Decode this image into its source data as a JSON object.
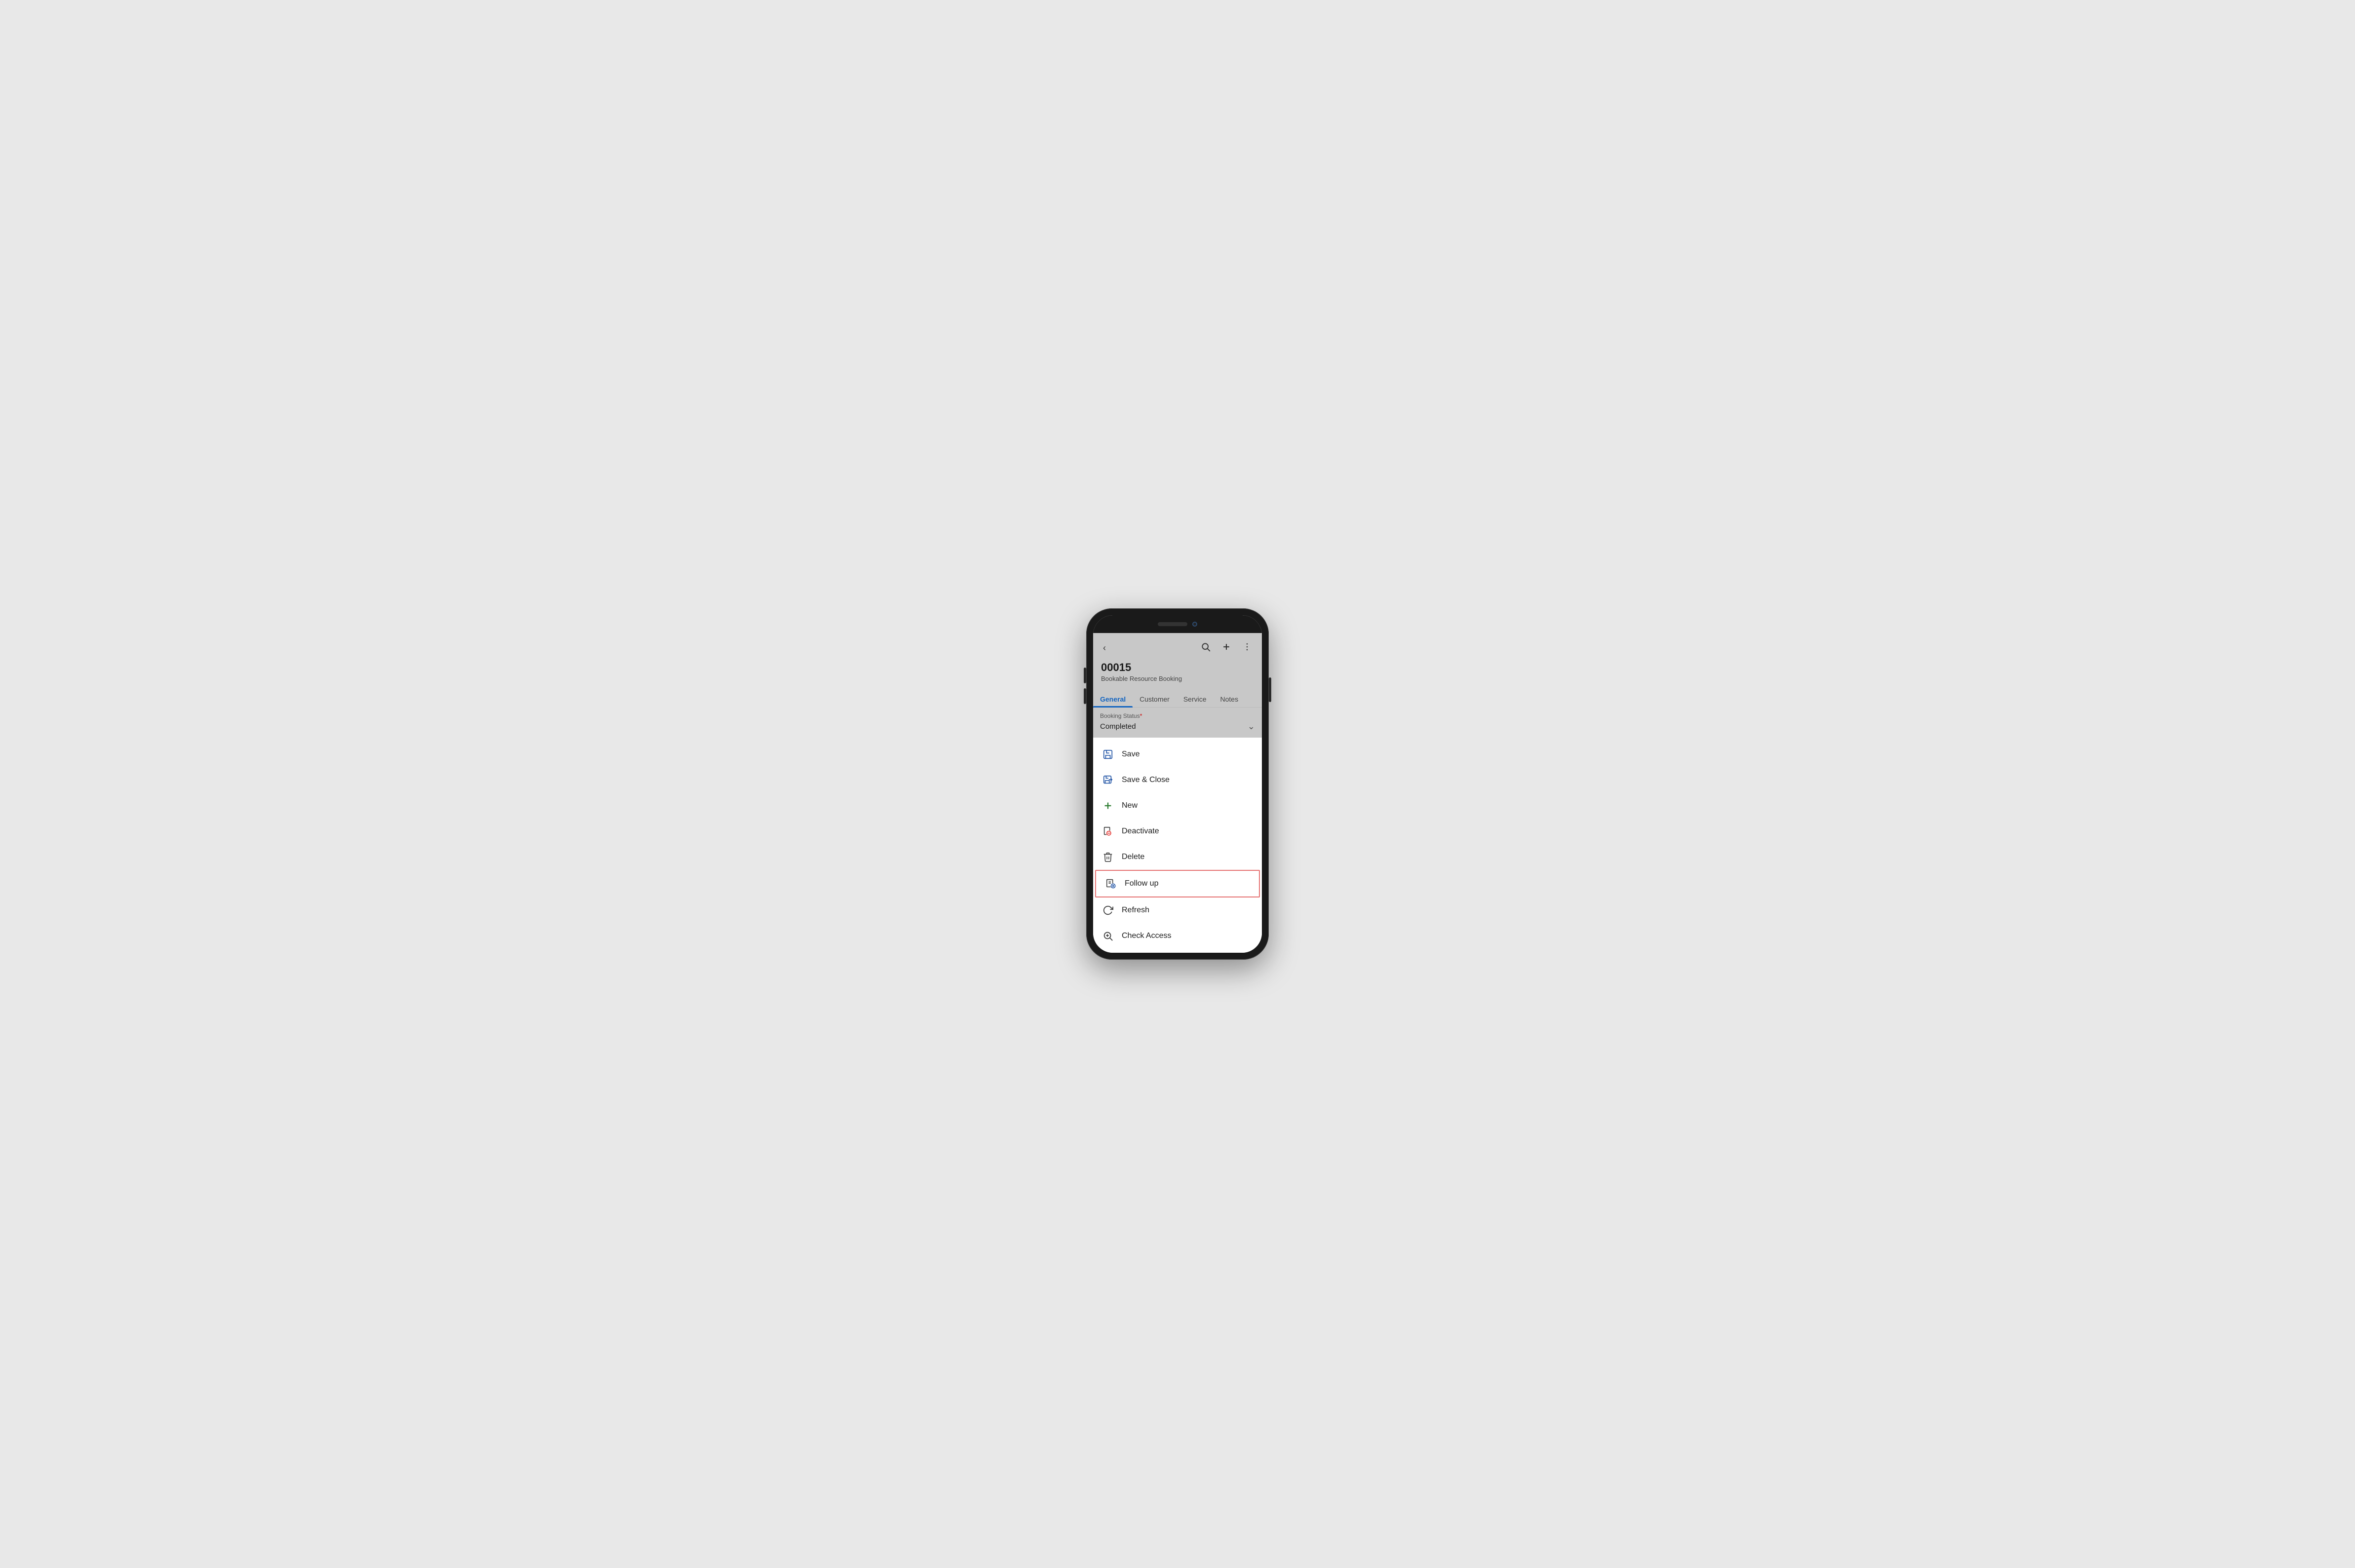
{
  "phone": {
    "notch": true
  },
  "header": {
    "record_id": "00015",
    "record_type": "Bookable Resource Booking",
    "back_label": "‹",
    "search_label": "⌕",
    "add_label": "+",
    "more_label": "⋮"
  },
  "tabs": [
    {
      "id": "general",
      "label": "General",
      "active": true
    },
    {
      "id": "customer",
      "label": "Customer",
      "active": false
    },
    {
      "id": "service",
      "label": "Service",
      "active": false
    },
    {
      "id": "notes",
      "label": "Notes",
      "active": false
    }
  ],
  "form": {
    "booking_status_label": "Booking Status",
    "booking_status_required": "*",
    "booking_status_value": "Completed"
  },
  "menu": {
    "items": [
      {
        "id": "save",
        "label": "Save",
        "icon": "save-icon",
        "highlighted": false
      },
      {
        "id": "save-close",
        "label": "Save & Close",
        "icon": "save-close-icon",
        "highlighted": false
      },
      {
        "id": "new",
        "label": "New",
        "icon": "new-icon",
        "highlighted": false
      },
      {
        "id": "deactivate",
        "label": "Deactivate",
        "icon": "deactivate-icon",
        "highlighted": false
      },
      {
        "id": "delete",
        "label": "Delete",
        "icon": "delete-icon",
        "highlighted": false
      },
      {
        "id": "follow-up",
        "label": "Follow up",
        "icon": "followup-icon",
        "highlighted": true
      },
      {
        "id": "refresh",
        "label": "Refresh",
        "icon": "refresh-icon",
        "highlighted": false
      },
      {
        "id": "check-access",
        "label": "Check Access",
        "icon": "check-access-icon",
        "highlighted": false
      }
    ]
  }
}
